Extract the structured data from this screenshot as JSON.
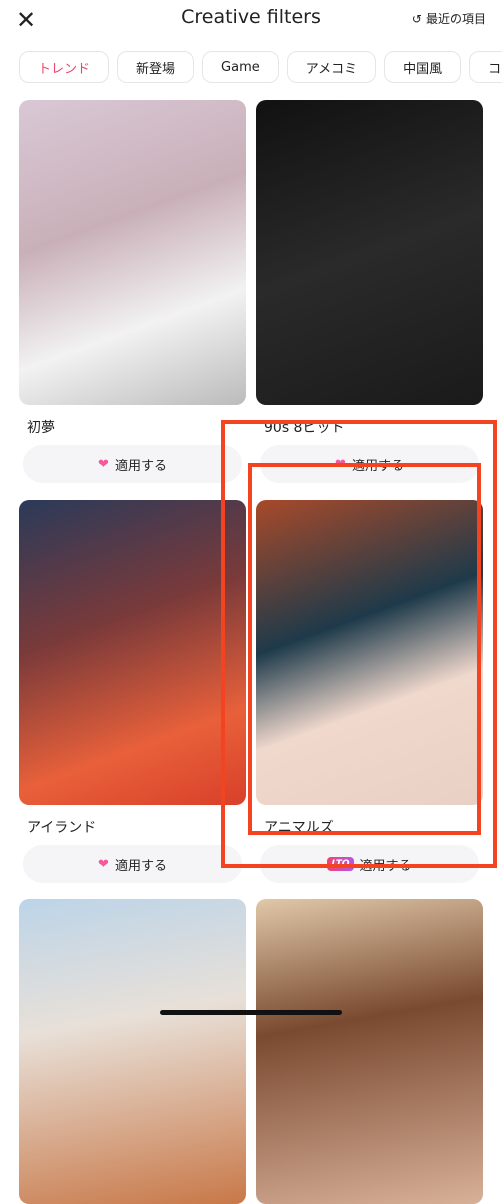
{
  "header": {
    "title": "Creative filters",
    "recent_label": "最近の項目",
    "close_icon": "close-icon",
    "history_icon": "history-icon"
  },
  "tabs": [
    {
      "label": "トレンド",
      "active": true
    },
    {
      "label": "新登場"
    },
    {
      "label": "Game"
    },
    {
      "label": "アメコミ"
    },
    {
      "label": "中国風"
    },
    {
      "label": "コ"
    }
  ],
  "filters": [
    {
      "name": "初夢",
      "button": "適用する",
      "badge": "heart"
    },
    {
      "name": "90s 8ビット",
      "button": "適用する",
      "badge": "heart"
    },
    {
      "name": "アイランド",
      "button": "適用する",
      "badge": "heart"
    },
    {
      "name": "アニマルズ",
      "button": "適用する",
      "badge": "LTO"
    },
    {
      "name": "",
      "button": ""
    },
    {
      "name": "",
      "button": ""
    }
  ],
  "colors": {
    "accent": "#f0436a",
    "highlight": "#f44320"
  }
}
